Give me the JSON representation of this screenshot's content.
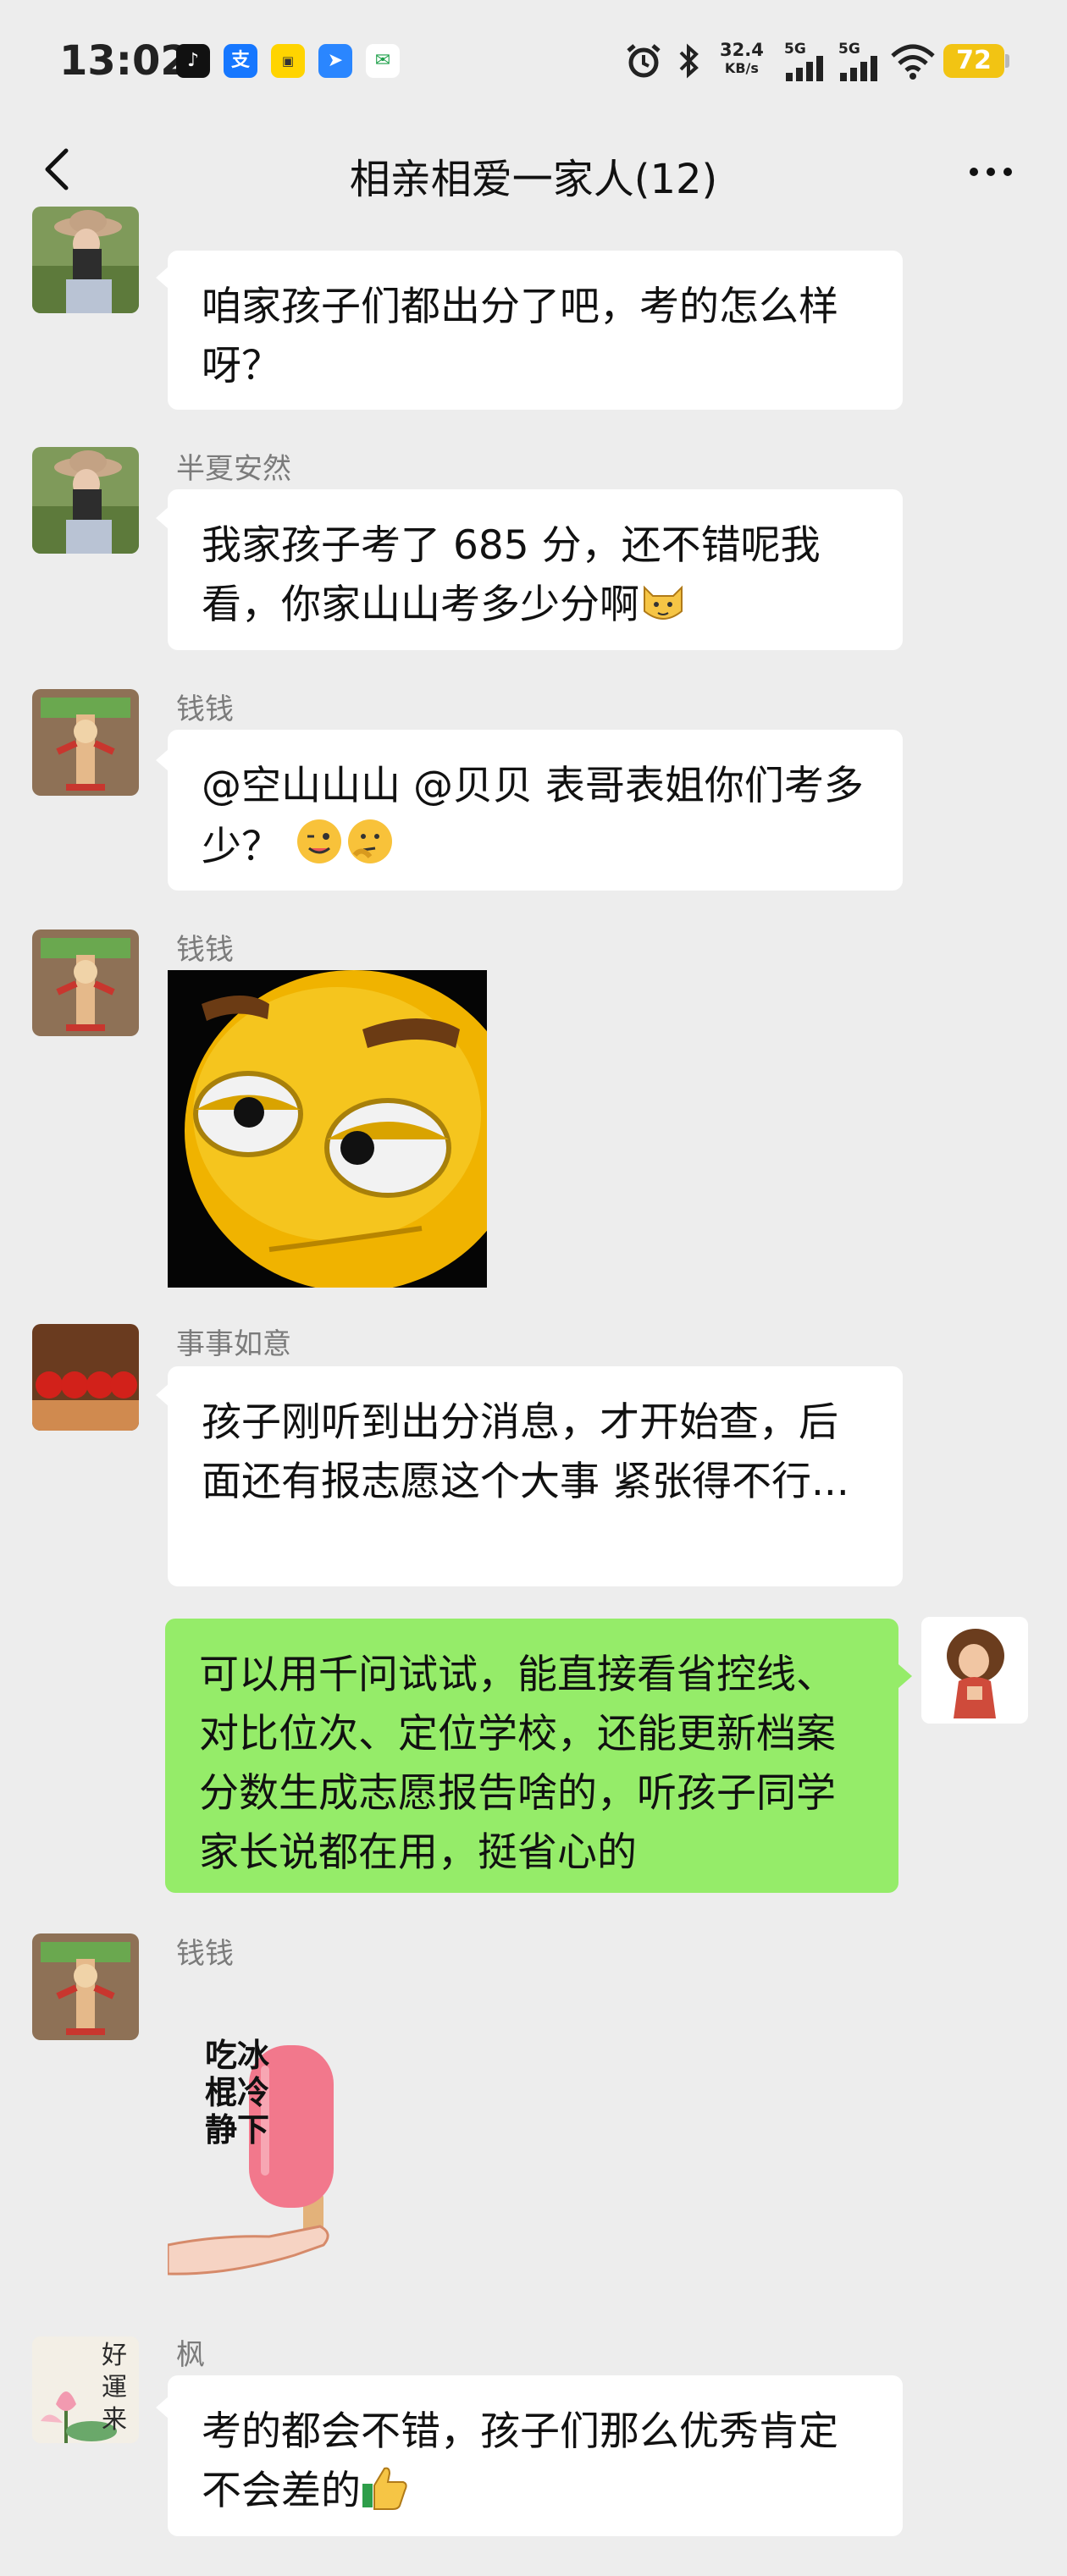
{
  "status_bar": {
    "time": "13:02",
    "net_speed_value": "32.4",
    "net_speed_unit": "KB/s",
    "signal1_label": "5G",
    "signal2_label": "5G",
    "battery": "72",
    "app_icons": [
      "tiktok-icon",
      "alipay-icon",
      "taobao-icon",
      "maps-icon",
      "china-post-icon"
    ]
  },
  "header": {
    "title": "相亲相爱一家人(12)"
  },
  "messages": [
    {
      "sender": "",
      "text": "咱家孩子们都出分了吧，考的怎么样呀？"
    },
    {
      "sender": "半夏安然",
      "text": "我家孩子考了 685 分，还不错呢我看，你家山山考多少分啊"
    },
    {
      "sender": "钱钱",
      "text": "@空山山山 @贝贝 表哥表姐你们考多少？"
    },
    {
      "sender": "钱钱",
      "sticker": "smirking-face-sticker"
    },
    {
      "sender": "事事如意",
      "text": "孩子刚听到出分消息，才开始查，后面还有报志愿这个大事 紧张得不行..."
    },
    {
      "sender": "",
      "self": true,
      "text": "可以用千问试试，能直接看省控线、对比位次、定位学校，还能更新档案分数生成志愿报告啥的，听孩子同学家长说都在用，挺省心的"
    },
    {
      "sender": "钱钱",
      "sticker": "popsicle-sticker",
      "sticker_text": [
        "吃冰",
        "棍冷",
        "静下"
      ]
    },
    {
      "sender": "枫",
      "text": "考的都会不错，孩子们那么优秀肯定不会差的"
    }
  ],
  "avatars": {
    "maple_calligraphy": [
      "好",
      "運",
      "来"
    ]
  },
  "colors": {
    "background": "#ededed",
    "self_bubble": "#95ec69",
    "other_bubble": "#ffffff",
    "battery": "#f2c413"
  }
}
